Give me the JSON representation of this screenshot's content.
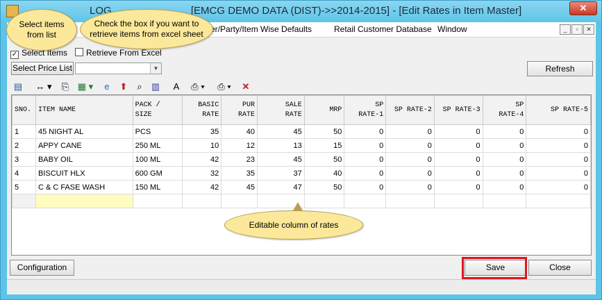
{
  "window": {
    "title_visible": "LOG",
    "title_rest": "[EMCG DEMO DATA (DIST)->>2014-2015] - [Edit Rates in Item Master]",
    "close_label": "✕"
  },
  "menu": {
    "items": [
      "plier/Party/Item Wise Defaults",
      "Retail Customer Database",
      "Window"
    ],
    "mdi_minimize": "_",
    "mdi_restore": "▫",
    "mdi_close": "✕"
  },
  "options": {
    "select_items_label": "Select Items",
    "select_items_checked": true,
    "retrieve_excel_label": "Retrieve From Excel",
    "retrieve_excel_checked": false,
    "price_list_button": "Select Price List",
    "price_list_value": "",
    "refresh_button": "Refresh"
  },
  "toolbar_icons": [
    "form-icon",
    "resize-columns-icon",
    "copy-icon",
    "excel-icon",
    "browser-icon",
    "up-arrow-icon",
    "find-icon",
    "chart-icon",
    "text-style-icon",
    "print-preview-icon",
    "printer-icon",
    "delete-icon"
  ],
  "grid": {
    "headers": [
      [
        "SNO."
      ],
      [
        "ITEM NAME"
      ],
      [
        "PACK /",
        "SIZE"
      ],
      [
        "BASIC",
        "RATE"
      ],
      [
        "PUR",
        "RATE"
      ],
      [
        "SALE",
        "RATE"
      ],
      [
        "MRP"
      ],
      [
        "SP",
        "RATE-1"
      ],
      [
        "SP RATE-2"
      ],
      [
        "SP RATE-3"
      ],
      [
        "SP",
        "RATE-4"
      ],
      [
        "SP RATE-5"
      ]
    ],
    "rows": [
      [
        "1",
        "45 NIGHT AL",
        "PCS",
        "35",
        "40",
        "45",
        "50",
        "0",
        "0",
        "0",
        "0",
        "0"
      ],
      [
        "2",
        "APPY CANE",
        "250 ML",
        "10",
        "12",
        "13",
        "15",
        "0",
        "0",
        "0",
        "0",
        "0"
      ],
      [
        "3",
        "BABY OIL",
        "100 ML",
        "42",
        "23",
        "45",
        "50",
        "0",
        "0",
        "0",
        "0",
        "0"
      ],
      [
        "4",
        "BISCUIT HLX",
        "600 GM",
        "32",
        "35",
        "37",
        "40",
        "0",
        "0",
        "0",
        "0",
        "0"
      ],
      [
        "5",
        "C & C FASE WASH",
        "150 ML",
        "42",
        "45",
        "47",
        "50",
        "0",
        "0",
        "0",
        "0",
        "0"
      ]
    ]
  },
  "footer": {
    "configuration_button": "Configuration",
    "save_button": "Save",
    "close_button": "Close"
  },
  "callouts": {
    "select_items": "Select items from list",
    "retrieve_excel": "Check the box if you want to retrieve items from excel sheet",
    "editable_rates": "Editable column of rates"
  },
  "colors": {
    "title_bar": "#5ec5e8",
    "callout_fill": "#fbe89a",
    "save_highlight": "#e0141c",
    "selected_cell": "#fffcc0"
  }
}
